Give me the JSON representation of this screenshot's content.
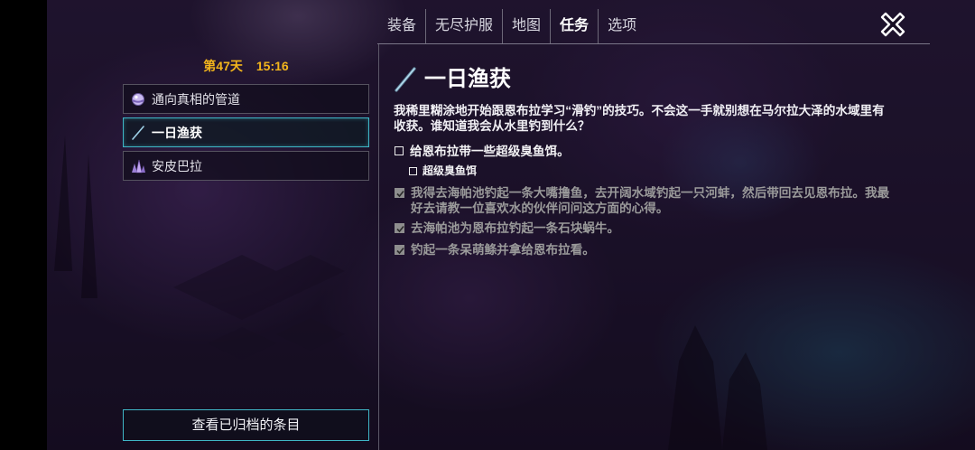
{
  "nav": {
    "tabs": [
      {
        "label": "装备",
        "selected": false
      },
      {
        "label": "无尽护服",
        "selected": false
      },
      {
        "label": "地图",
        "selected": false
      },
      {
        "label": "任务",
        "selected": true
      },
      {
        "label": "选项",
        "selected": false
      }
    ],
    "close_icon": "close-icon"
  },
  "sidebar": {
    "day": "第47天",
    "time": "15:16",
    "quests": [
      {
        "label": "通向真相的管道",
        "icon": "orb-icon",
        "selected": false
      },
      {
        "label": "一日渔获",
        "icon": "fishing-rod-icon",
        "selected": true
      },
      {
        "label": "安皮巴拉",
        "icon": "crystal-icon",
        "selected": false
      }
    ],
    "archive_button": "查看已归档的条目"
  },
  "quest_detail": {
    "icon": "fishing-rod-icon",
    "title": "一日渔获",
    "description": "我稀里糊涂地开始跟恩布拉学习“滑钓”的技巧。不会这一手就别想在马尔拉大泽的水域里有收获。谁知道我会从水里钓到什么？",
    "objectives": [
      {
        "text": "给恩布拉带一些超级臭鱼饵。",
        "done": false,
        "sub": false
      },
      {
        "text": "超级臭鱼饵",
        "done": false,
        "sub": true
      },
      {
        "text": "我得去海帕池钓起一条大嘴撸鱼，去开阔水域钓起一只河蚌，然后带回去见恩布拉。我最好去请教一位喜欢水的伙伴问问这方面的心得。",
        "done": true,
        "sub": false
      },
      {
        "text": "去海帕池为恩布拉钓起一条石块蜗牛。",
        "done": true,
        "sub": false
      },
      {
        "text": "钓起一条呆萌鲦并拿给恩布拉看。",
        "done": true,
        "sub": false
      }
    ]
  },
  "colors": {
    "accent": "#3fb6c6",
    "date": "#f2b51c",
    "done": "#9a9a9a",
    "border": "#55525f"
  }
}
